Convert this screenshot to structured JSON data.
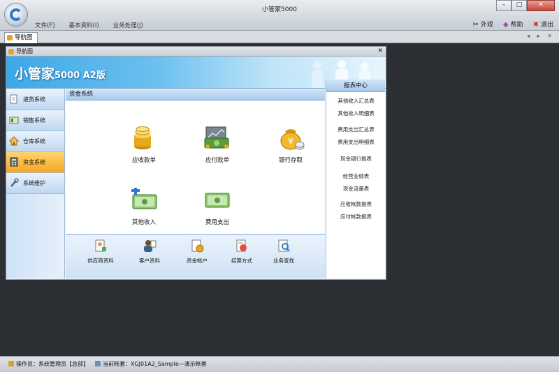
{
  "window": {
    "title": "小管家5000",
    "min_glyph": "–",
    "max_glyph": "□",
    "close_glyph": "✕"
  },
  "menu": {
    "items": [
      "文件(F)",
      "基本资料(I)",
      "业务处理(J)"
    ]
  },
  "top_right": {
    "appearance": "外观",
    "help": "帮助",
    "exit": "退出"
  },
  "doc_tab": {
    "label": "导航图",
    "ctrl": "◂ ▸ ✕"
  },
  "nav_window": {
    "title": "导航图",
    "close": "✕"
  },
  "banner": {
    "brand": "小管家",
    "edition": "5000 A2版"
  },
  "left_nav": {
    "items": [
      {
        "label": "进货系统",
        "icon": "document-icon"
      },
      {
        "label": "销售系统",
        "icon": "sales-icon"
      },
      {
        "label": "仓库系统",
        "icon": "house-icon"
      },
      {
        "label": "资金系统",
        "icon": "calculator-icon"
      },
      {
        "label": "系统维护",
        "icon": "wrench-icon"
      }
    ],
    "active_index": 3
  },
  "section": {
    "title": "资金系统"
  },
  "functions": [
    {
      "label": "应收款单",
      "icon": "coins-icon"
    },
    {
      "label": "应付款单",
      "icon": "money-pile-icon"
    },
    {
      "label": "银行存取",
      "icon": "money-bag-icon"
    },
    {
      "label": "其他收入",
      "icon": "banknote-plus-icon"
    },
    {
      "label": "费用支出",
      "icon": "banknote-icon"
    }
  ],
  "bottom_items": [
    {
      "label": "供应商资料",
      "icon": "supplier-icon"
    },
    {
      "label": "客户资料",
      "icon": "customer-icon"
    },
    {
      "label": "资金帐户",
      "icon": "account-icon"
    },
    {
      "label": "结算方式",
      "icon": "settlement-icon"
    },
    {
      "label": "业务查找",
      "icon": "search-doc-icon"
    }
  ],
  "report_center": {
    "title": "报表中心",
    "links": [
      "其他收入汇总表",
      "其他收入明细表",
      "费用支出汇总表",
      "费用支出明细表",
      "现金银行报表",
      "经营业绩表",
      "现金流量表",
      "应收帐款报表",
      "应付帐款报表"
    ]
  },
  "status": {
    "operator": "操作员：系统管理员【总部】",
    "account": "当前帐套：XGJ01A2_Sample—演示帐套"
  },
  "colors": {
    "accent_orange": "#f5a623",
    "nav_blue": "#bed7f1",
    "banner_blue": "#3da8e6"
  }
}
